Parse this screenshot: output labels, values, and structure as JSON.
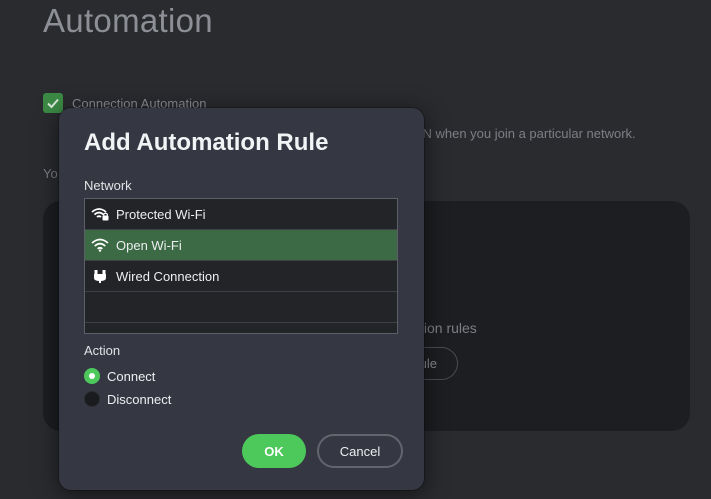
{
  "page": {
    "title": "Automation",
    "connection_automation_label": "Connection Automation",
    "description_fragment": "'N when you join a particular network.",
    "you_text": "Yo",
    "empty_text": "tion rules",
    "add_rule_label": "ule"
  },
  "dialog": {
    "title": "Add Automation Rule",
    "network_label": "Network",
    "networks": [
      {
        "name": "Protected Wi-Fi",
        "icon": "wifi-lock-icon",
        "selected": false
      },
      {
        "name": "Open Wi-Fi",
        "icon": "wifi-icon",
        "selected": true
      },
      {
        "name": "Wired Connection",
        "icon": "ethernet-icon",
        "selected": false
      }
    ],
    "action_label": "Action",
    "actions": [
      {
        "label": "Connect",
        "selected": true
      },
      {
        "label": "Disconnect",
        "selected": false
      }
    ],
    "ok_label": "OK",
    "cancel_label": "Cancel"
  },
  "colors": {
    "accent": "#4cc95a",
    "selected_row": "#3b6a44",
    "dialog_bg": "#353842",
    "page_bg": "#2a2b2f"
  }
}
